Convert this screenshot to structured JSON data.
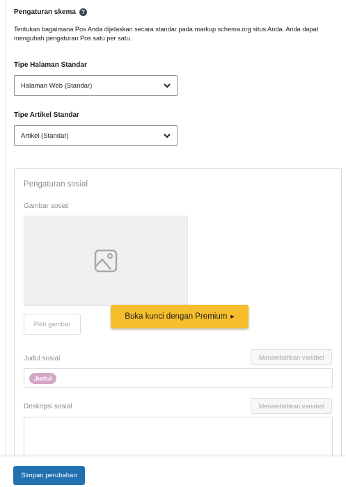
{
  "schema": {
    "title": "Pengaturan skema",
    "help_icon": "?",
    "description": "Tentukan bagaimana Pos Anda dijelaskan secara standar pada markup schema.org situs Anda. Anda dapat mengubah pengaturan Pos satu per satu."
  },
  "page_type": {
    "label": "Tipe Halaman Standar",
    "value": "Halaman Web (Standar)"
  },
  "article_type": {
    "label": "Tipe Artikel Standar",
    "value": "Artikel (Standar)"
  },
  "social": {
    "title": "Pengaturan sosial",
    "image_label": "Gambar sosial",
    "pick_image": "Pilih gambar",
    "premium": "Buka kunci dengan Premium",
    "premium_arrow": "▶",
    "title_label": "Judul sosial",
    "add_variable": "Menambahkan variabel",
    "title_chip": "Judul",
    "description_label": "Deskripsi sosial",
    "add_variable_2": "Menambahkan variabel"
  },
  "footer": {
    "save": "Simpan perubahan"
  },
  "colors": {
    "primary_button": "#2271b1",
    "premium": "#f6be2c",
    "chip": "#d5a6c6"
  },
  "icons": {
    "help": "help-circle-icon",
    "select": "chevron-down-icon",
    "image": "image-placeholder-icon",
    "premium": "caret-right-icon"
  }
}
